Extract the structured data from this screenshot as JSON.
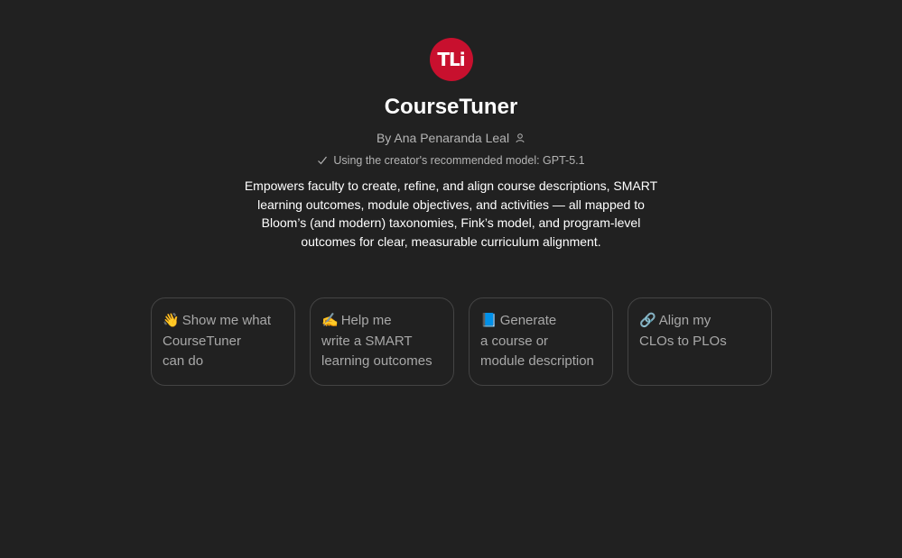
{
  "gpt": {
    "logo_text": "TLi",
    "title": "CourseTuner",
    "byline": "By Ana Penaranda Leal",
    "model_note": "Using the creator's recommended model: GPT-5.1",
    "description": "Empowers faculty to create, refine, and align course descriptions, SMART learning outcomes, module objectives, and activities — all mapped to Bloom’s (and modern) taxonomies, Fink’s model, and program-level outcomes for clear, measurable curriculum alignment."
  },
  "colors": {
    "background": "#212121",
    "logo_red": "#c8102e",
    "card_border": "#444444"
  },
  "starters": [
    {
      "emoji": "👋",
      "lines": [
        "Show me what",
        "CourseTuner",
        "can do"
      ]
    },
    {
      "emoji": "✍️",
      "lines": [
        "Help me",
        "write a SMART",
        "learning outcomes"
      ]
    },
    {
      "emoji": "📘",
      "lines": [
        "Generate",
        "a course or",
        "module description"
      ]
    },
    {
      "emoji": "🔗",
      "lines": [
        "Align my",
        "CLOs to PLOs",
        ""
      ]
    }
  ]
}
